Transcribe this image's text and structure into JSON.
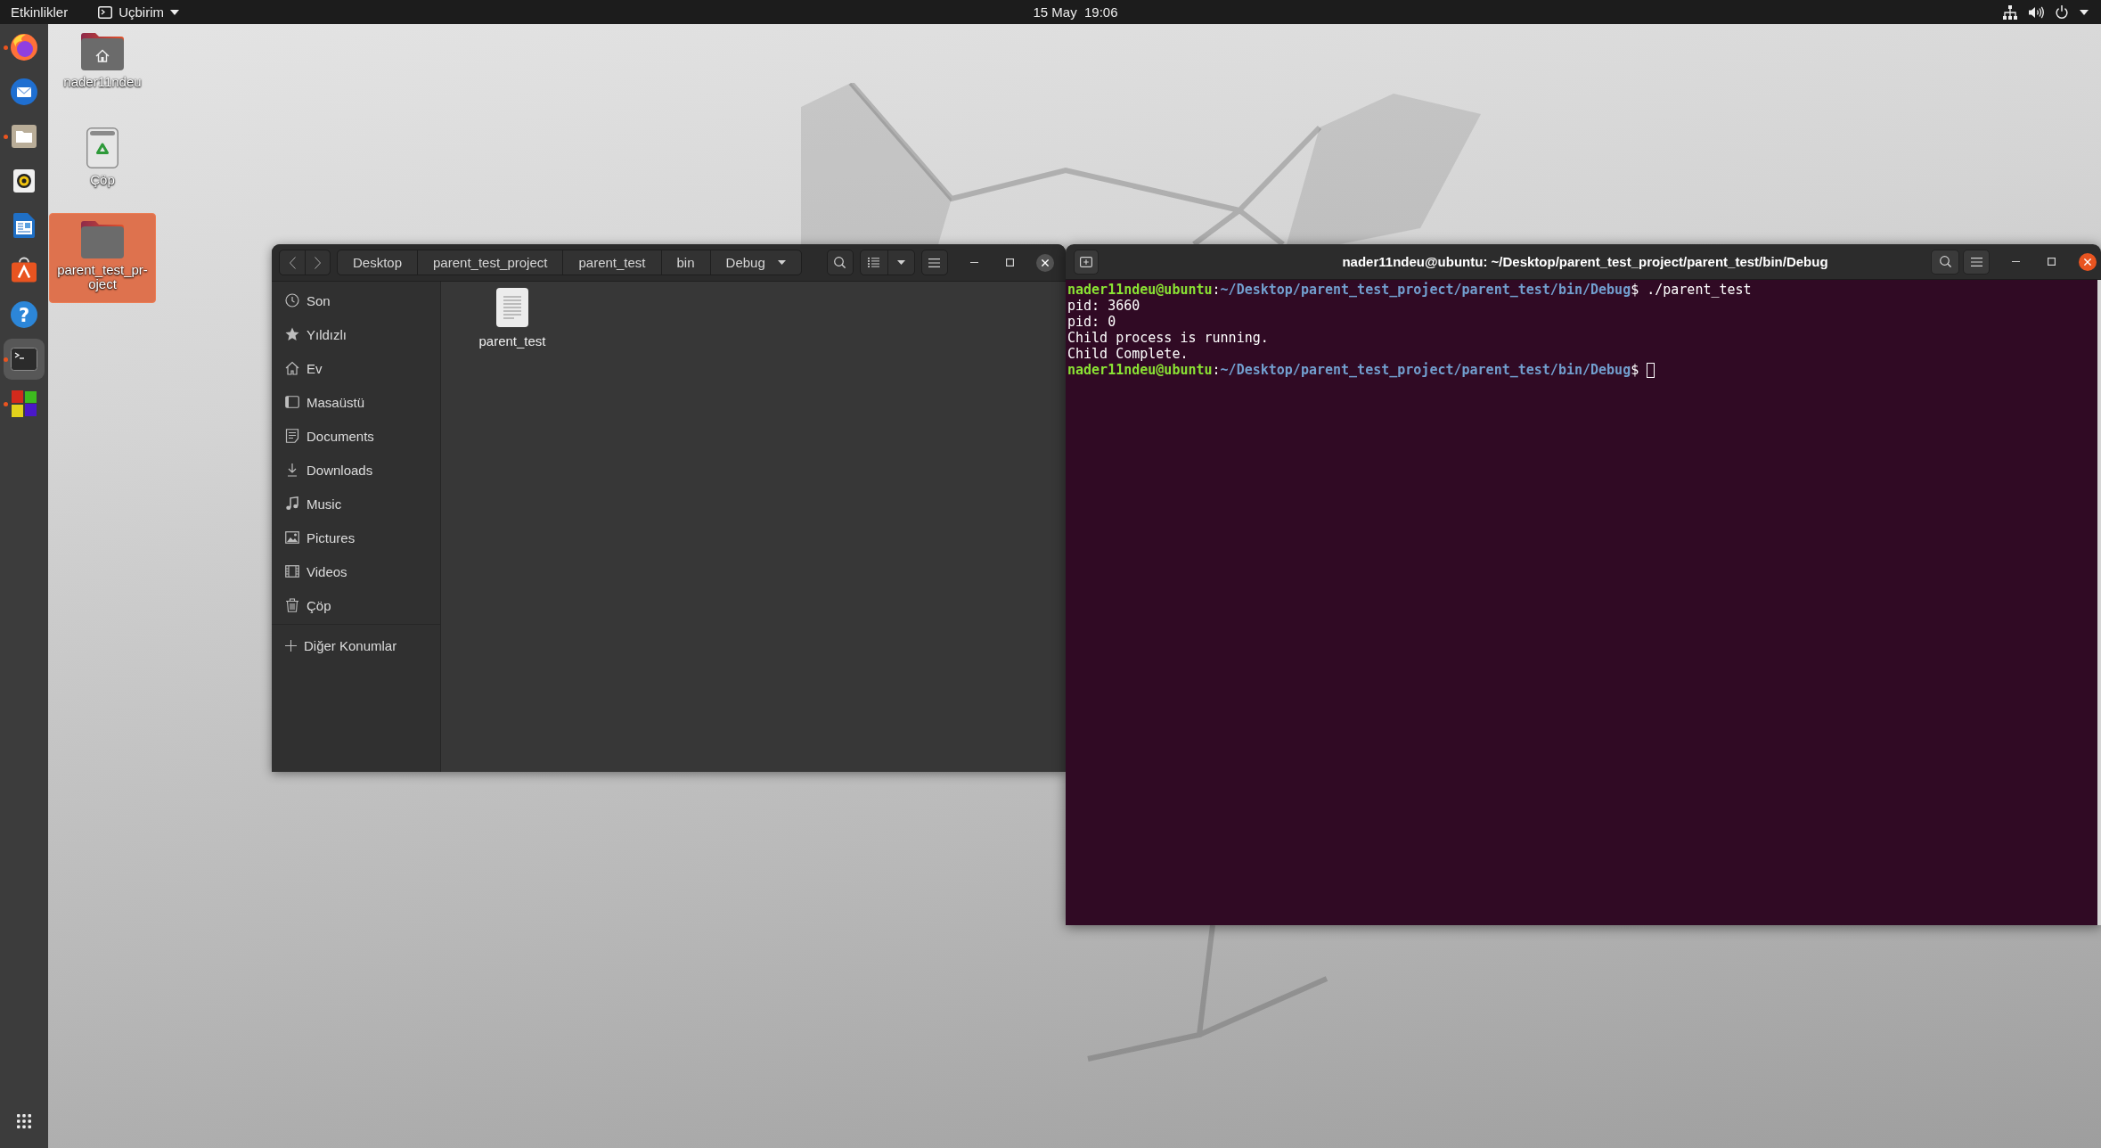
{
  "top_bar": {
    "activities": "Etkinlikler",
    "app_menu": "Uçbirim",
    "clock": "15 May  19:06"
  },
  "dock": {
    "items": [
      {
        "kind": "browser",
        "running": true,
        "active": false
      },
      {
        "kind": "mail",
        "running": false,
        "active": false
      },
      {
        "kind": "files",
        "running": true,
        "active": false
      },
      {
        "kind": "music",
        "running": false,
        "active": false
      },
      {
        "kind": "writer",
        "running": false,
        "active": false
      },
      {
        "kind": "store",
        "running": false,
        "active": false
      },
      {
        "kind": "help",
        "glyph": "?",
        "running": false,
        "active": false
      },
      {
        "kind": "terminal",
        "running": true,
        "active": true
      },
      {
        "kind": "blocks",
        "running": true,
        "active": false
      }
    ]
  },
  "desktop": {
    "items": [
      {
        "kind": "home",
        "label": "nader11ndeu",
        "selected": false
      },
      {
        "kind": "trash",
        "label": "Çöp",
        "selected": false
      },
      {
        "kind": "folder",
        "label": "parent_test_pr-oject",
        "selected": true
      }
    ]
  },
  "files_window": {
    "path": [
      {
        "label": "Desktop",
        "current": false
      },
      {
        "label": "parent_test_project",
        "current": false
      },
      {
        "label": "parent_test",
        "current": false
      },
      {
        "label": "bin",
        "current": false
      },
      {
        "label": "Debug",
        "current": true
      }
    ],
    "sidebar": [
      {
        "kind": "recent",
        "label": "Son",
        "selected": false
      },
      {
        "kind": "starred",
        "label": "Yıldızlı",
        "selected": false
      },
      {
        "kind": "home",
        "label": "Ev",
        "selected": false
      },
      {
        "kind": "desktop",
        "label": "Masaüstü",
        "selected": false
      },
      {
        "kind": "documents",
        "label": "Documents",
        "selected": false
      },
      {
        "kind": "downloads",
        "label": "Downloads",
        "selected": false
      },
      {
        "kind": "music",
        "label": "Music",
        "selected": false
      },
      {
        "kind": "pictures",
        "label": "Pictures",
        "selected": false
      },
      {
        "kind": "videos",
        "label": "Videos",
        "selected": false
      },
      {
        "kind": "trash",
        "label": "Çöp",
        "selected": false
      }
    ],
    "other_locations": "Diğer Konumlar",
    "files": [
      {
        "kind": "text",
        "name": "parent_test",
        "selected": false
      }
    ]
  },
  "terminal_window": {
    "title": "nader11ndeu@ubuntu: ~/Desktop/parent_test_project/parent_test/bin/Debug",
    "lines": [
      {
        "kind": "prompt",
        "user": "nader11ndeu@ubuntu",
        "separator": ":",
        "path": "~/Desktop/parent_test_project/parent_test/bin/Debug",
        "symbol": "$",
        "command": "./parent_test",
        "cursor": false
      },
      {
        "kind": "output",
        "text": "pid: 3660"
      },
      {
        "kind": "output",
        "text": "pid: 0"
      },
      {
        "kind": "output",
        "text": "Child process is running."
      },
      {
        "kind": "output",
        "text": "Child Complete."
      },
      {
        "kind": "prompt",
        "user": "nader11ndeu@ubuntu",
        "separator": ":",
        "path": "~/Desktop/parent_test_project/parent_test/bin/Debug",
        "symbol": "$",
        "cursor": true
      }
    ]
  }
}
